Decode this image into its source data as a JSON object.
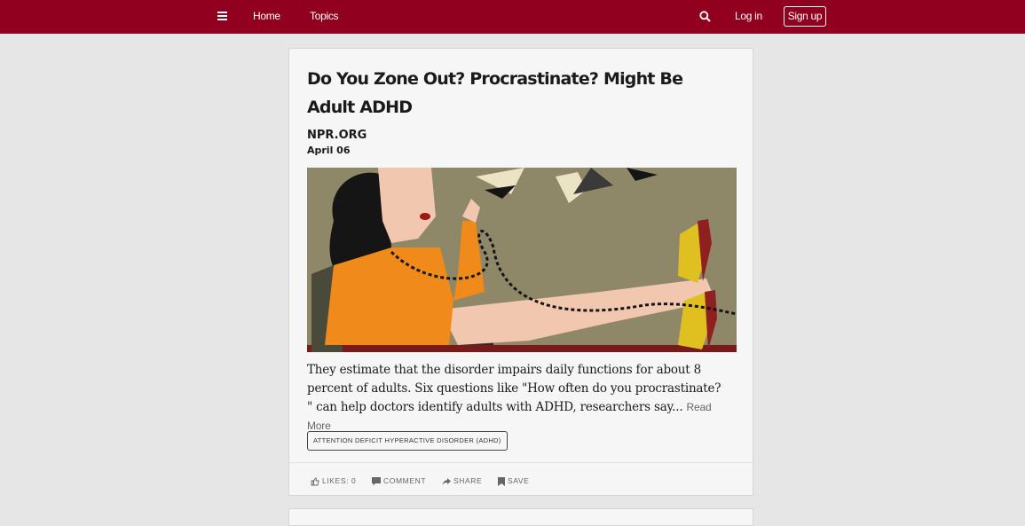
{
  "nav": {
    "home_label": "Home",
    "topics_label": "Topics",
    "login_label": "Log in",
    "signup_label": "Sign up"
  },
  "colors": {
    "topbar": "#920020",
    "page_background": "#e6e6e6",
    "card_background": "#f6f6f6"
  },
  "article": {
    "title": "Do You Zone Out? Procrastinate? Might Be Adult ADHD",
    "source": "NPR.ORG",
    "date": "April 06",
    "summary": "They estimate that the disorder impairs daily functions for about 8 percent of adults. Six questions like \"How often do you procrastinate? \" can help doctors identify adults with ADHD, researchers say...",
    "read_more": "Read More",
    "tag": "ATTENTION DEFICIT HYPERACTIVE DISORDER (ADHD)"
  },
  "actions": {
    "likes_label": "LIKES: 0",
    "comment_label": "COMMENT",
    "share_label": "SHARE",
    "save_label": "SAVE"
  },
  "icons": {
    "menu": "hamburger-icon",
    "search": "search-icon",
    "like": "thumbs-up-icon",
    "comment": "comment-icon",
    "share": "share-icon",
    "save": "bookmark-icon"
  }
}
